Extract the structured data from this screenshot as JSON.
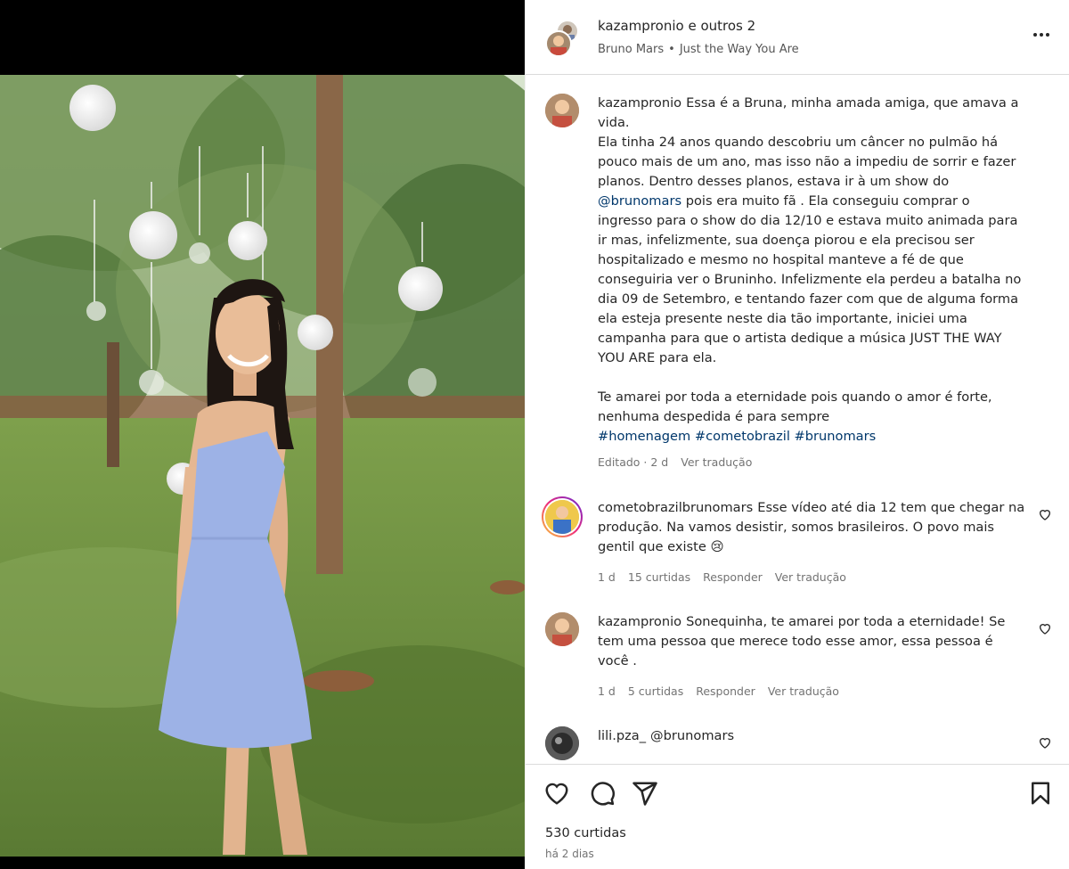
{
  "header": {
    "username": "kazampronio e outros 2",
    "music_artist": "Bruno Mars",
    "music_separator": "•",
    "music_title": "Just the Way You Are"
  },
  "caption": {
    "username": "kazampronio",
    "text_1": "Essa é a Bruna, minha amada amiga, que amava a vida.",
    "text_2": "Ela tinha 24 anos quando descobriu um câncer no pulmão há pouco mais de um ano, mas isso não a impediu de sorrir e fazer planos. Dentro desses planos, estava ir à um show do",
    "mention": "@brunomars",
    "text_3": "pois era muito fã . Ela conseguiu comprar o ingresso para o show do dia 12/10 e estava muito animada para ir mas, infelizmente, sua doença piorou e ela precisou ser hospitalizado e mesmo no hospital manteve a fé de que conseguiria ver o Bruninho. Infelizmente ela perdeu a batalha no dia 09 de Setembro, e tentando fazer com que de alguma forma ela esteja presente neste dia tão importante, iniciei uma campanha para que o artista dedique a música JUST THE WAY YOU ARE para ela.",
    "text_4": "Te amarei por toda a eternidade pois quando o amor é forte, nenhuma despedida é para sempre",
    "hashtags": "#homenagem #cometobrazil #brunomars",
    "edited": "Editado · 2 d",
    "translate": "Ver tradução"
  },
  "comments": [
    {
      "username": "cometobrazilbrunomars",
      "text": "Esse vídeo até dia 12 tem que chegar na produção. Na vamos desistir, somos brasileiros. O povo mais gentil que existe 😢",
      "time": "1 d",
      "likes": "15 curtidas",
      "reply": "Responder",
      "translate": "Ver tradução"
    },
    {
      "username": "kazampronio",
      "text": "Sonequinha, te amarei por toda a eternidade! Se tem uma pessoa que merece todo esse amor, essa pessoa é você .",
      "time": "1 d",
      "likes": "5 curtidas",
      "reply": "Responder",
      "translate": "Ver tradução"
    },
    {
      "username": "lili.pza_",
      "text": "@brunomars"
    }
  ],
  "footer": {
    "likes": "530 curtidas",
    "posted": "há 2 dias"
  },
  "icons": {
    "like": "heart-icon",
    "comment": "comment-icon",
    "share": "share-icon",
    "save": "bookmark-icon",
    "more": "more-options-icon"
  },
  "colors": {
    "link": "#00376b",
    "text": "#262626",
    "muted": "#737373",
    "dress": "#9db2e6"
  }
}
